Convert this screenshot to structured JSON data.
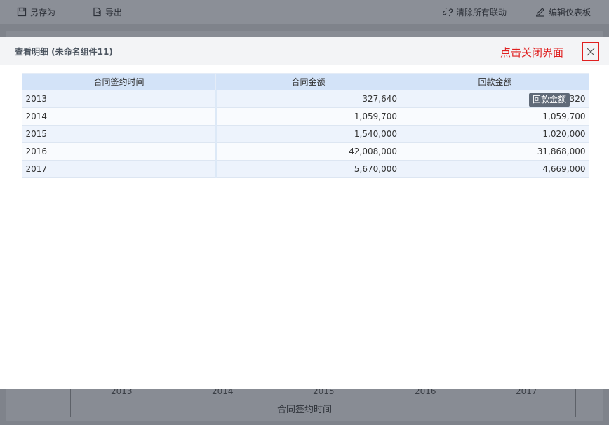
{
  "toolbar": {
    "save_as": "另存为",
    "export": "导出",
    "clear_links": "清除所有联动",
    "edit_dashboard": "编辑仪表板"
  },
  "background_chart": {
    "x_ticks": [
      "2013",
      "2014",
      "2015",
      "2016",
      "2017"
    ],
    "x_title": "合同签约时间"
  },
  "modal": {
    "title": "查看明细 (未命名组件11)",
    "hint": "点击关闭界面",
    "close_icon": "close-icon",
    "tooltip": "回款金额",
    "table": {
      "headers": [
        "合同签约时间",
        "合同金额",
        "回款金额"
      ],
      "rows": [
        [
          "2013",
          "327,640",
          "327,320"
        ],
        [
          "2014",
          "1,059,700",
          "1,059,700"
        ],
        [
          "2015",
          "1,540,000",
          "1,020,000"
        ],
        [
          "2016",
          "42,008,000",
          "31,868,000"
        ],
        [
          "2017",
          "5,670,000",
          "4,669,000"
        ]
      ]
    }
  },
  "colors": {
    "hint_red": "#e02020",
    "header_blue": "#d3e3f8",
    "tooltip_bg": "#606a78"
  }
}
